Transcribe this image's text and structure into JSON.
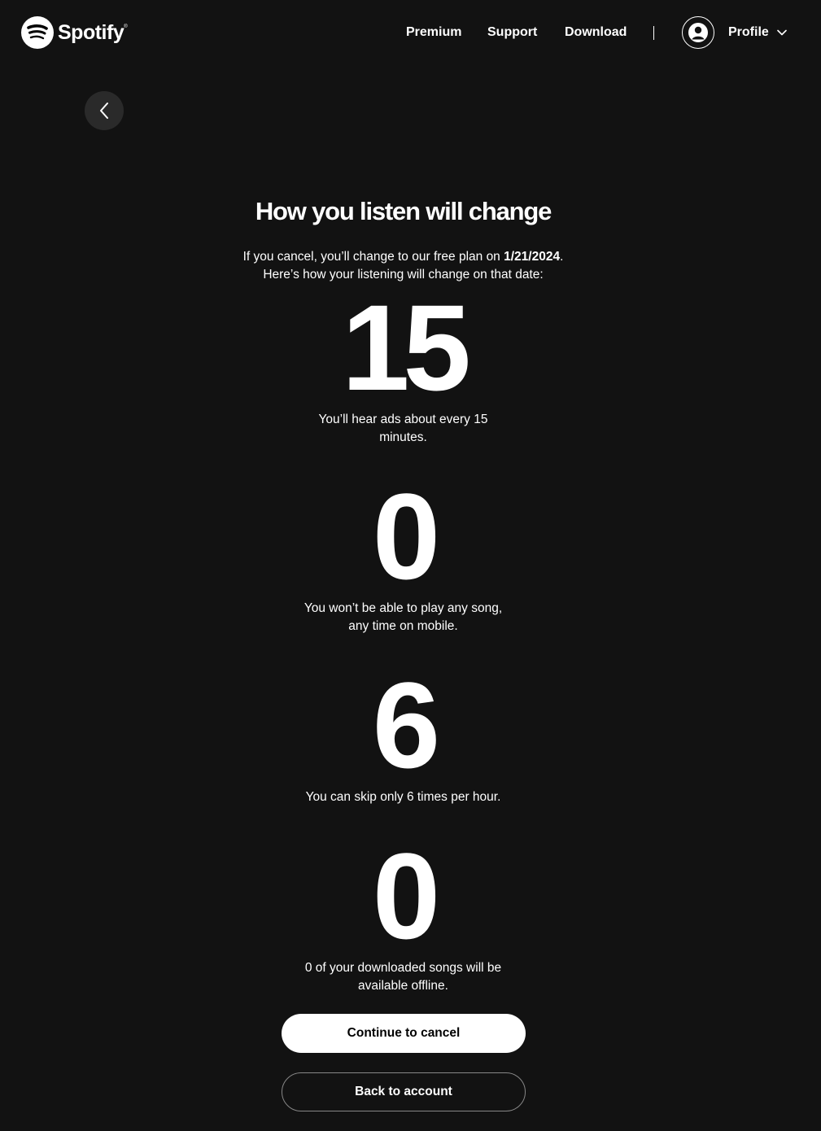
{
  "header": {
    "brand": "Spotify",
    "nav": {
      "premium": "Premium",
      "support": "Support",
      "download": "Download"
    },
    "profile_label": "Profile"
  },
  "main": {
    "title": "How you listen will change",
    "intro_prefix": "If you cancel, you’ll change to our free plan on ",
    "intro_date": "1/21/2024",
    "intro_suffix": ".",
    "intro_line2": "Here’s how your listening will change on that date:",
    "stats": [
      {
        "value": "15",
        "text": "You’ll hear ads about every 15 minutes."
      },
      {
        "value": "0",
        "text": "You won’t be able to play any song, any time on mobile."
      },
      {
        "value": "6",
        "text": "You can skip only 6 times per hour."
      },
      {
        "value": "0",
        "text": "0 of your downloaded songs will be available offline."
      }
    ],
    "continue_label": "Continue to cancel",
    "back_label": "Back to account"
  },
  "colors": {
    "background": "#121212",
    "text": "#ffffff",
    "back_button_bg": "#2a2a2a",
    "primary_button_bg": "#ffffff",
    "secondary_border": "#878787"
  },
  "icons": {
    "logo": "spotify-logo-icon",
    "back": "chevron-left-icon",
    "avatar": "user-icon",
    "dropdown": "chevron-down-icon"
  }
}
